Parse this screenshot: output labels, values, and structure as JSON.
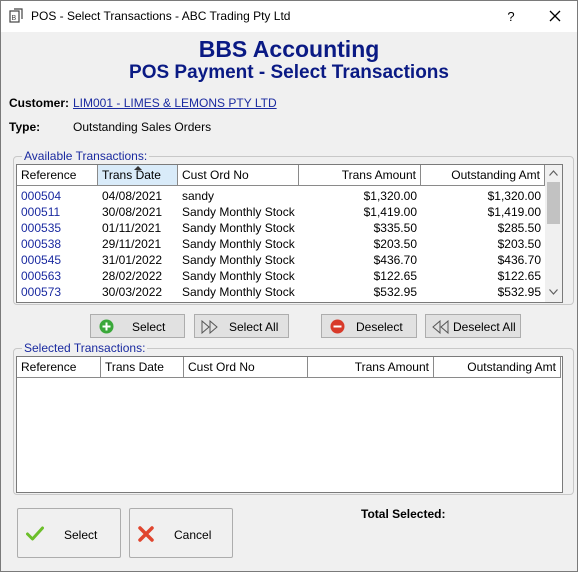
{
  "window": {
    "title": "POS - Select Transactions - ABC Trading Pty Ltd",
    "help": "?"
  },
  "heading": {
    "line1": "BBS Accounting",
    "line2": "POS Payment - Select Transactions"
  },
  "customer": {
    "label": "Customer:",
    "value": "LIM001 - LIMES & LEMONS PTY LTD"
  },
  "type": {
    "label": "Type:",
    "value": "Outstanding Sales Orders"
  },
  "available": {
    "legend": "Available Transactions:",
    "columns": [
      "Reference",
      "Trans Date",
      "Cust Ord No",
      "Trans Amount",
      "Outstanding Amt"
    ],
    "rows": [
      [
        "000504",
        "04/08/2021",
        "sandy",
        "$1,320.00",
        "$1,320.00"
      ],
      [
        "000511",
        "30/08/2021",
        "Sandy Monthly Stock",
        "$1,419.00",
        "$1,419.00"
      ],
      [
        "000535",
        "01/11/2021",
        "Sandy Monthly Stock",
        "$335.50",
        "$285.50"
      ],
      [
        "000538",
        "29/11/2021",
        "Sandy Monthly Stock",
        "$203.50",
        "$203.50"
      ],
      [
        "000545",
        "31/01/2022",
        "Sandy Monthly Stock",
        "$436.70",
        "$436.70"
      ],
      [
        "000563",
        "28/02/2022",
        "Sandy Monthly Stock",
        "$122.65",
        "$122.65"
      ],
      [
        "000573",
        "30/03/2022",
        "Sandy Monthly Stock",
        "$532.95",
        "$532.95"
      ]
    ]
  },
  "buttons": {
    "select": "Select",
    "select_all": "Select All",
    "deselect": "Deselect",
    "deselect_all": "Deselect All"
  },
  "selected": {
    "legend": "Selected Transactions:",
    "columns": [
      "Reference",
      "Trans Date",
      "Cust Ord No",
      "Trans Amount",
      "Outstanding Amt"
    ]
  },
  "footer": {
    "total_label": "Total Selected:",
    "select": "Select",
    "cancel": "Cancel"
  },
  "colors": {
    "heading": "#0a1a84",
    "link": "#1a2aa0",
    "select_icon": "#3aa83a",
    "deselect_icon": "#d83a2a"
  }
}
